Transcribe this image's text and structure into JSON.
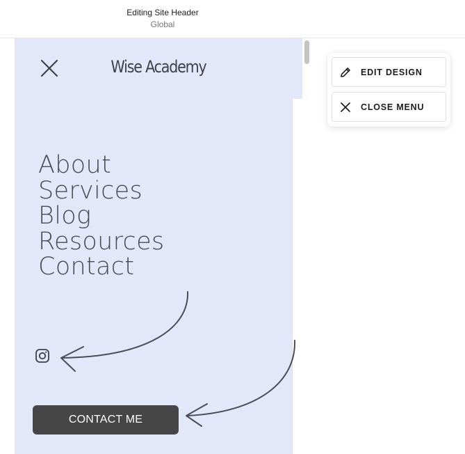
{
  "header": {
    "title": "Editing Site Header",
    "subtitle": "Global"
  },
  "site": {
    "brand": "Wise Academy",
    "nav_items": [
      "About",
      "Services",
      "Blog",
      "Resources",
      "Contact"
    ],
    "contact_button": "CONTACT ME",
    "icons": {
      "close": "close-icon",
      "social": "instagram-icon"
    },
    "colors": {
      "menu_background": "#e2e7fa",
      "nav_text": "#4a4a52",
      "button_background": "#464646",
      "button_text": "#ffffff"
    }
  },
  "editor_menu": {
    "edit_design": "EDIT DESIGN",
    "close_menu": "CLOSE MENU",
    "icons": {
      "edit_design": "pencil-icon",
      "close_menu": "close-icon"
    }
  },
  "annotations": {
    "arrow_color": "#4b4b55",
    "arrows": [
      "arrow-to-instagram-icon",
      "arrow-to-contact-button"
    ]
  }
}
